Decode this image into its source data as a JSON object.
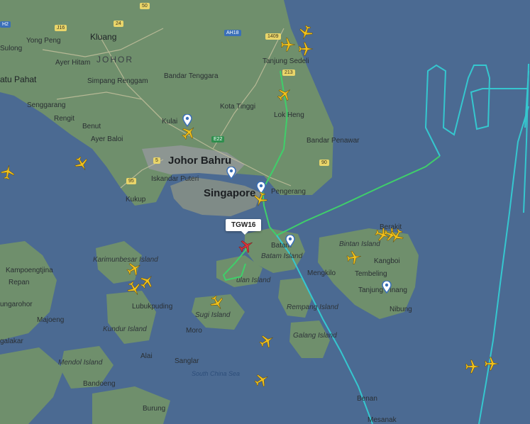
{
  "map": {
    "flight_callsign": "TGW16",
    "colors": {
      "sea": "#4b6a92",
      "land": "#6f8f6c",
      "city": "#9aa09c",
      "track_green": "#3fcf6a",
      "track_cyan": "#35c7cf",
      "track_blue": "#3a7cd6",
      "selected_plane": "#d9333a",
      "plane": "#f2c21c"
    },
    "region_labels": {
      "johor": "JOHOR",
      "south_china_sea": "South China Sea"
    },
    "places": {
      "kluang": "Kluang",
      "yong_peng": "Yong Peng",
      "sulong": "Sulong",
      "ayer_hitam": "Ayer Hitam",
      "batu_pahat": "atu Pahat",
      "simpang_renggam": "Simpang Renggam",
      "bandar_tenggara": "Bandar Tenggara",
      "senggarang": "Senggarang",
      "rengit": "Rengit",
      "benut": "Benut",
      "ayer_baloi": "Ayer Baloi",
      "kulai": "Kulai",
      "kota_tinggi": "Kota Tinggi",
      "lok_heng": "Lok Heng",
      "bandar_penawar": "Bandar Penawar",
      "tanjung_sedeli": "Tanjung Sedeli",
      "johor_bahru": "Johor Bahru",
      "iskandar_puteri": "Iskandar Puteri",
      "singapore": "Singapore",
      "pengerang": "Pengerang",
      "kukup": "Kukup",
      "batam": "Batam",
      "batam_island": "Batam Island",
      "bintan_island": "Bintan Island",
      "berakit": "Berakit",
      "kangboi": "Kangboi",
      "tembeling": "Tembeling",
      "tanjung_pinang": "Tanjung Pinang",
      "nibung": "Nibung",
      "mengkilo": "Mengkilo",
      "karimunbesar_island": "Karimunbesar Island",
      "kampoengtjina": "Kampoengtjina",
      "repan": "Repan",
      "ungarohor": "ungarohor",
      "majoeng": "Majoeng",
      "galakar": "galakar",
      "lubukpuding": "Lubukpuding",
      "kundur_island": "Kundur Island",
      "sugi_island": "Sugi Island",
      "moro": "Moro",
      "alai": "Alai",
      "mendol_island": "Mendol Island",
      "bandoeng": "Bandoeng",
      "sanglar": "Sanglar",
      "burung": "Burung",
      "rempang_island": "Rempang Island",
      "galang_island": "Galang Island",
      "benan": "Benan",
      "mesanak": "Mesanak",
      "bulan_island": "ulan Island"
    },
    "road_shields": {
      "r50": "50",
      "r1409": "1409",
      "ah18": "AH18",
      "r213": "213",
      "j16": "J16",
      "r24": "24",
      "e22": "E22",
      "r5": "5",
      "r95": "95",
      "r90": "90",
      "h2": "H2"
    },
    "planes": [
      {
        "id": "p1",
        "heading": 200
      },
      {
        "id": "p2",
        "heading": 90
      },
      {
        "id": "p3",
        "heading": 90
      },
      {
        "id": "p4",
        "heading": 50
      },
      {
        "id": "p5",
        "heading": 45
      },
      {
        "id": "p6",
        "heading": 150
      },
      {
        "id": "p7",
        "heading": 10
      },
      {
        "id": "p8",
        "heading": 200
      },
      {
        "id": "p9",
        "heading": 110
      },
      {
        "id": "p10",
        "heading": 110
      },
      {
        "id": "p11",
        "heading": 80
      },
      {
        "id": "p12",
        "heading": 60
      },
      {
        "id": "p13",
        "heading": 40
      },
      {
        "id": "p14",
        "heading": 150
      },
      {
        "id": "p15",
        "heading": 150
      },
      {
        "id": "p16",
        "heading": 60
      },
      {
        "id": "p17",
        "heading": 60
      },
      {
        "id": "p18",
        "heading": 90
      },
      {
        "id": "p19",
        "heading": 90
      },
      {
        "id": "p20",
        "heading": 210
      }
    ]
  }
}
